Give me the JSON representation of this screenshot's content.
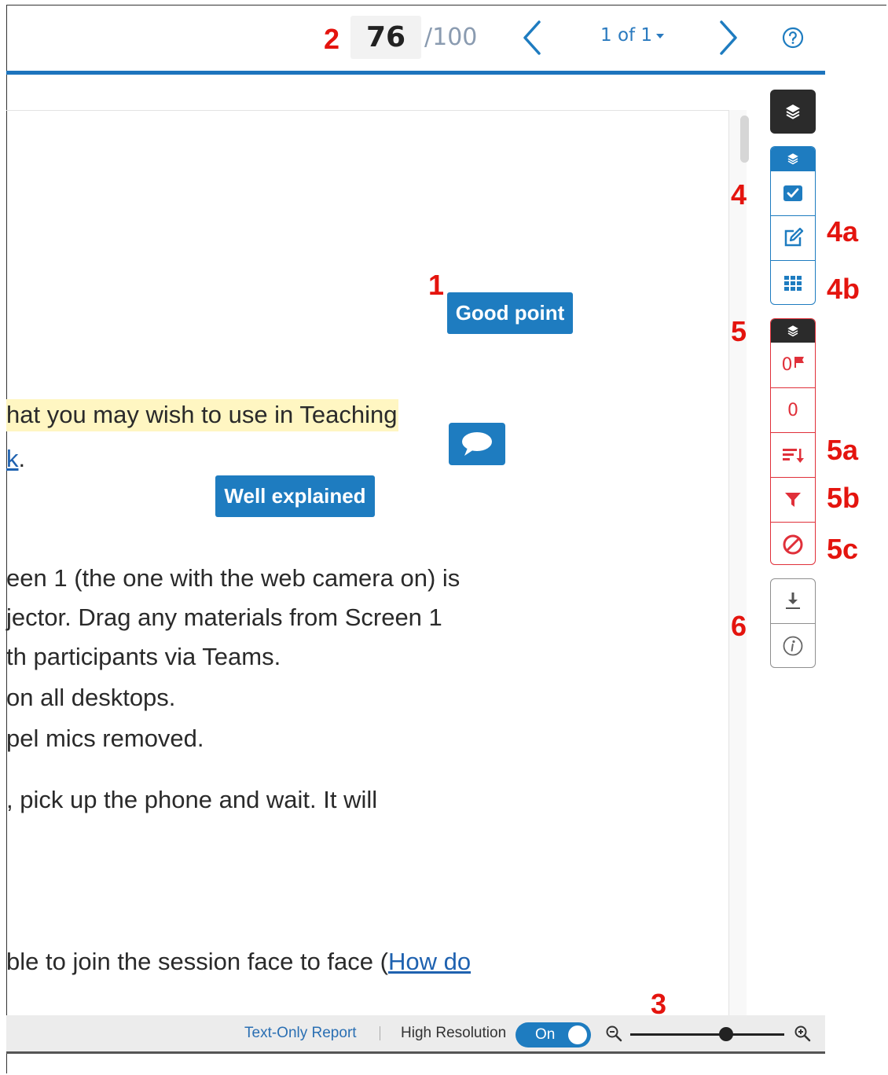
{
  "header": {
    "grade_value": "76",
    "grade_total": "/100",
    "page_selector": "1 of 1"
  },
  "document": {
    "lines": [
      "hat you may wish to use in Teaching",
      ".",
      "een 1 (the one with the web camera on) is",
      "jector. Drag any materials from Screen 1",
      "th participants via Teams.",
      "on all desktops.",
      "pel mics removed.",
      ", pick up the phone and wait. It will",
      "ble to join the session face to face ("
    ],
    "link_fragment_1": "k",
    "link_fragment_2": "How do"
  },
  "quickmarks": {
    "good_point": "Good point",
    "well_explained": "Well explained"
  },
  "sidebar": {
    "flag_count": "0",
    "count": "0"
  },
  "annotations": {
    "a1": "1",
    "a2": "2",
    "a3": "3",
    "a4": "4",
    "a4a": "4a",
    "a4b": "4b",
    "a5": "5",
    "a5a": "5a",
    "a5b": "5b",
    "a5c": "5c",
    "a6": "6"
  },
  "bottom_bar": {
    "text_only_report": "Text-Only Report",
    "high_resolution_label": "High Resolution",
    "toggle_state": "On",
    "zoom_level": 0.62
  },
  "colors": {
    "accent_blue": "#1e7cc0",
    "annotation_red": "#e4140e",
    "flag_red": "#e0303a",
    "highlight_yellow": "#fff6c2"
  }
}
